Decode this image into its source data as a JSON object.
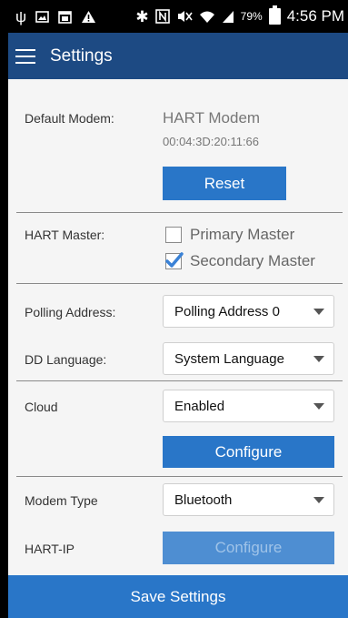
{
  "status_bar": {
    "battery_percent": "79%",
    "time": "4:56 PM",
    "icons": [
      "usb-icon",
      "image-icon",
      "calendar-icon",
      "warning-icon",
      "bluetooth-icon",
      "nfc-icon",
      "mute-icon",
      "wifi-icon",
      "signal-icon",
      "battery-icon"
    ]
  },
  "app_bar": {
    "title": "Settings"
  },
  "default_modem": {
    "label": "Default Modem:",
    "name": "HART Modem",
    "address": "00:04:3D:20:11:66",
    "reset_label": "Reset"
  },
  "hart_master": {
    "label": "HART Master:",
    "primary_label": "Primary Master",
    "primary_checked": false,
    "secondary_label": "Secondary Master",
    "secondary_checked": true
  },
  "polling_address": {
    "label": "Polling Address:",
    "value": "Polling Address 0"
  },
  "dd_language": {
    "label": "DD Language:",
    "value": "System Language"
  },
  "cloud": {
    "label": "Cloud",
    "value": "Enabled",
    "configure_label": "Configure"
  },
  "modem_type": {
    "label": "Modem Type",
    "value": "Bluetooth"
  },
  "hart_ip": {
    "label": "HART-IP",
    "configure_label": "Configure"
  },
  "save_label": "Save Settings",
  "colors": {
    "app_bar": "#1d4a83",
    "accent": "#2976c8",
    "check": "#3b82d6"
  }
}
